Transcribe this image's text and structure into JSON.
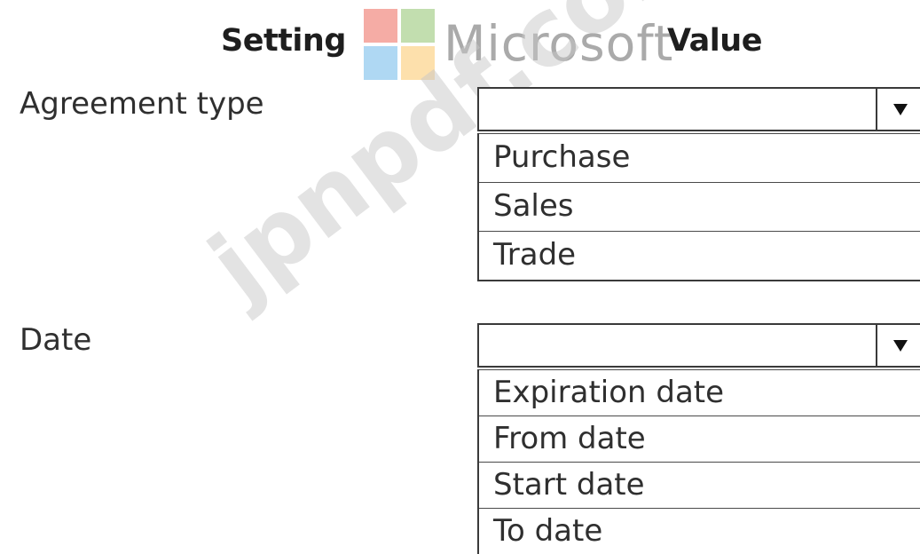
{
  "header": {
    "setting_label": "Setting",
    "value_label": "Value"
  },
  "branding": {
    "logo_text": "Microsoft",
    "logo_colors": [
      "#f25022",
      "#7fba00",
      "#00a4ef",
      "#ffb900"
    ]
  },
  "watermark": {
    "text": "jpnpdf.com"
  },
  "settings": [
    {
      "label": "Agreement type",
      "selected_value": "",
      "options": [
        "Purchase",
        "Sales",
        "Trade"
      ]
    },
    {
      "label": "Date",
      "selected_value": "",
      "options": [
        "Expiration date",
        "From date",
        "Start date",
        "To date"
      ]
    }
  ]
}
